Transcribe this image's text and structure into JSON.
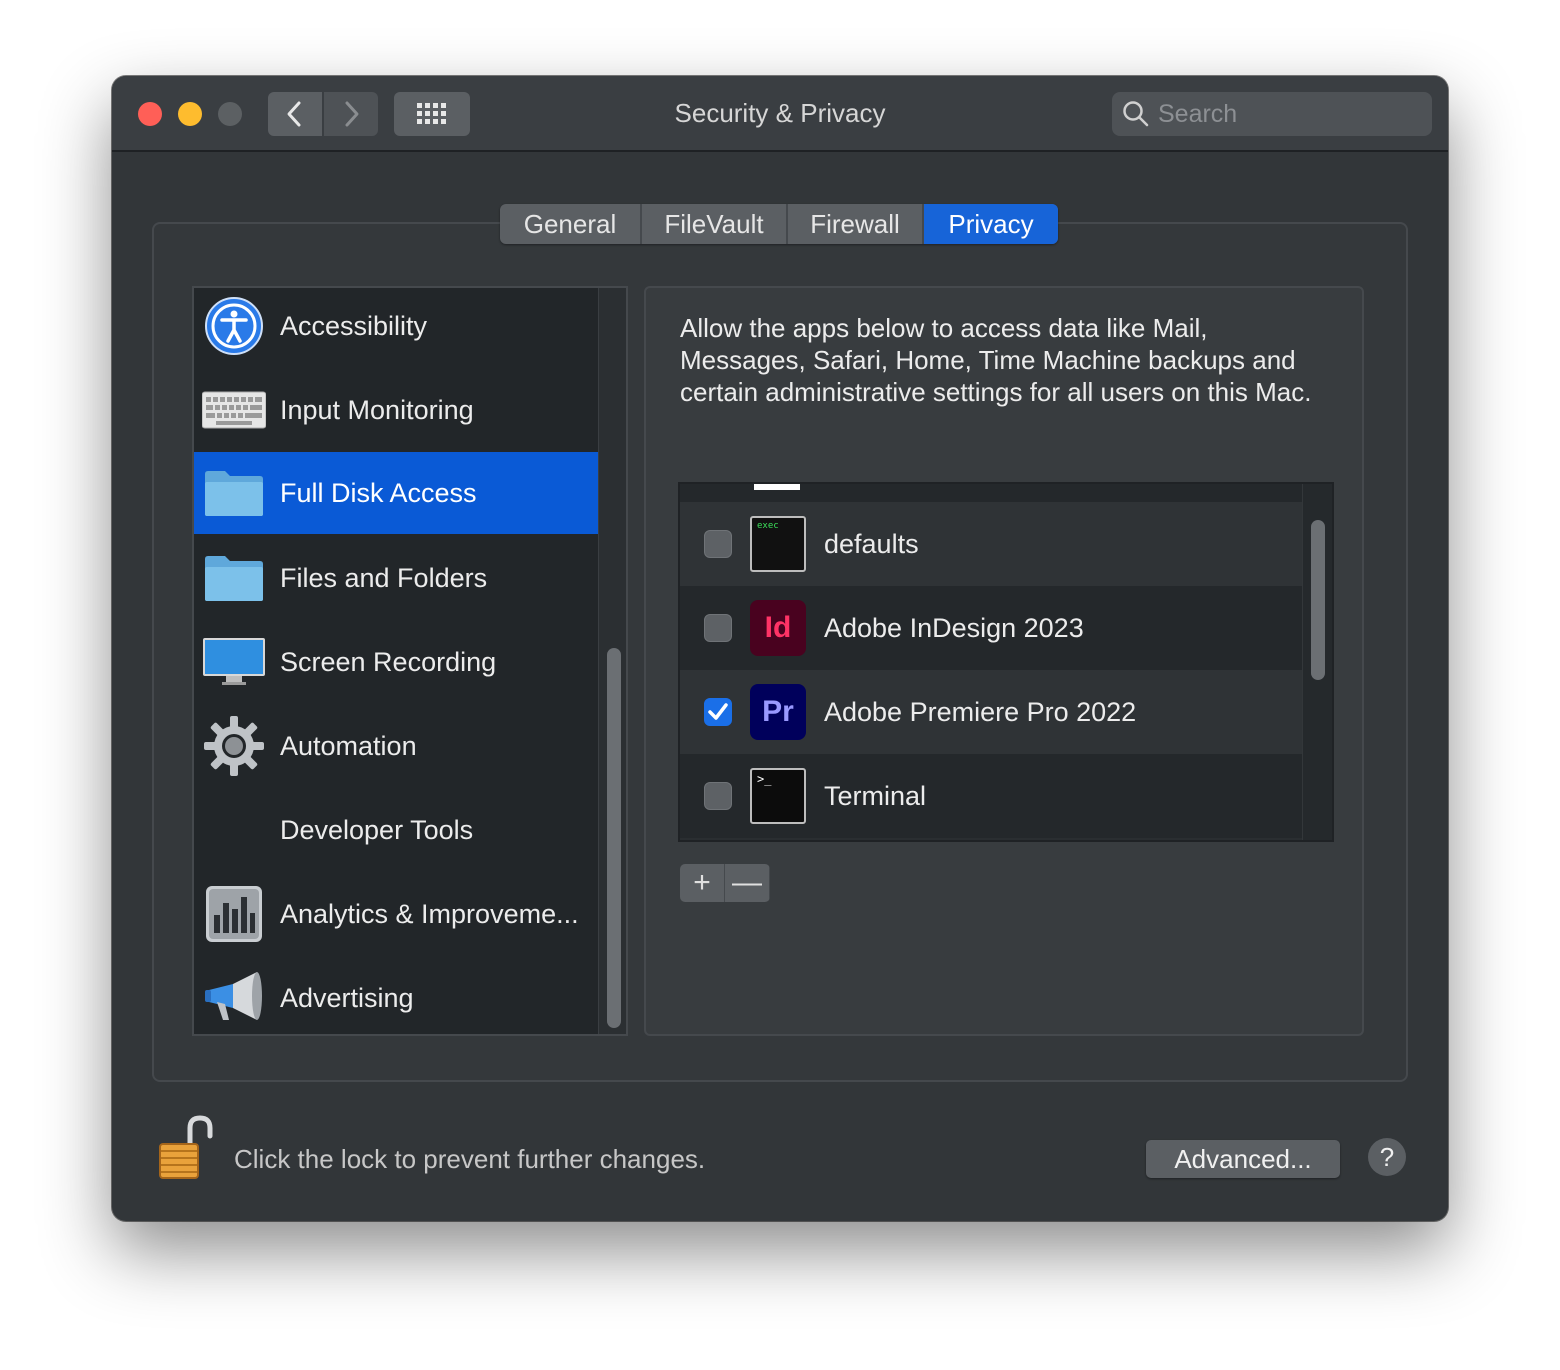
{
  "window": {
    "title": "Security & Privacy",
    "search_placeholder": "Search"
  },
  "tabs": [
    {
      "label": "General",
      "active": false
    },
    {
      "label": "FileVault",
      "active": false
    },
    {
      "label": "Firewall",
      "active": false
    },
    {
      "label": "Privacy",
      "active": true
    }
  ],
  "sidebar": {
    "items": [
      {
        "label": "Accessibility",
        "icon": "accessibility-icon"
      },
      {
        "label": "Input Monitoring",
        "icon": "keyboard-icon"
      },
      {
        "label": "Full Disk Access",
        "icon": "folder-icon",
        "selected": true
      },
      {
        "label": "Files and Folders",
        "icon": "folder-icon"
      },
      {
        "label": "Screen Recording",
        "icon": "display-icon"
      },
      {
        "label": "Automation",
        "icon": "gear-icon"
      },
      {
        "label": "Developer Tools",
        "icon": ""
      },
      {
        "label": "Analytics & Improveme...",
        "icon": "analytics-icon"
      },
      {
        "label": "Advertising",
        "icon": "megaphone-icon"
      }
    ]
  },
  "content": {
    "description": "Allow the apps below to access data like Mail, Messages, Safari, Home, Time Machine backups and certain administrative settings for all users on this Mac.",
    "apps": [
      {
        "name": "defaults",
        "checked": false,
        "icon": "exec-icon",
        "icon_text": "exec"
      },
      {
        "name": "Adobe InDesign 2023",
        "checked": false,
        "icon": "indesign-icon",
        "icon_text": "Id"
      },
      {
        "name": "Adobe Premiere Pro 2022",
        "checked": true,
        "icon": "premiere-icon",
        "icon_text": "Pr"
      },
      {
        "name": "Terminal",
        "checked": false,
        "icon": "terminal-icon",
        "icon_text": ">_"
      }
    ],
    "add_label": "+",
    "remove_label": "—"
  },
  "footer": {
    "lock_text": "Click the lock to prevent further changes.",
    "advanced_label": "Advanced...",
    "help_label": "?"
  },
  "colors": {
    "accent": "#1764d8",
    "selection": "#0a5ad6",
    "window_bg": "#323639"
  }
}
